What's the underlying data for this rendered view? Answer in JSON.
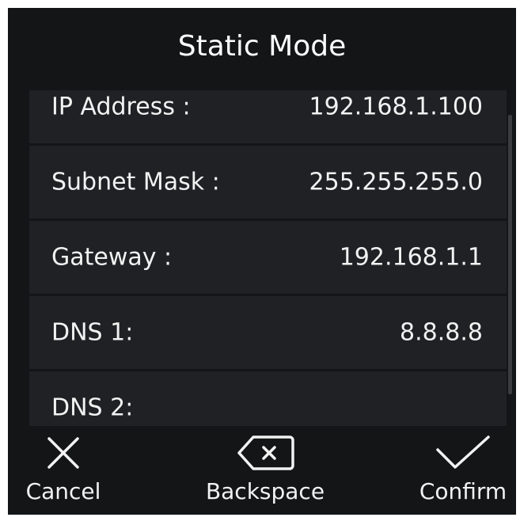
{
  "title": "Static Mode",
  "fields": [
    {
      "label": "IP Address :",
      "value": "192.168.1.100"
    },
    {
      "label": "Subnet Mask :",
      "value": "255.255.255.0"
    },
    {
      "label": "Gateway :",
      "value": "192.168.1.1"
    },
    {
      "label": "DNS 1:",
      "value": "8.8.8.8"
    },
    {
      "label": "DNS 2:",
      "value": ""
    }
  ],
  "buttons": {
    "cancel": {
      "label": "Cancel",
      "icon": "close-icon"
    },
    "backspace": {
      "label": "Backspace",
      "icon": "backspace-icon"
    },
    "confirm": {
      "label": "Confirm",
      "icon": "check-icon"
    }
  },
  "colors": {
    "background": "#141517",
    "row": "#1f2124",
    "text": "#f2f2f2"
  }
}
